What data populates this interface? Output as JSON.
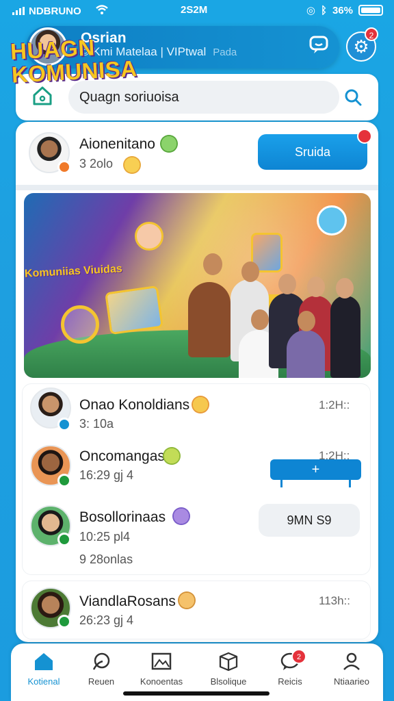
{
  "status_bar": {
    "carrier": "NDBRUNO",
    "time": "2S2M",
    "battery": "36%"
  },
  "header": {
    "title": "Osrian",
    "subtitle": "© Kmi Matelaa | VIPtwal",
    "subtitle_dim": "Pada",
    "notification_count": "2"
  },
  "search": {
    "value": "Quagn soriuoisa"
  },
  "top_post": {
    "name": "Aionenitano",
    "meta": "3 2olo",
    "button_label": "Sruida"
  },
  "banner": {
    "title_line1": "HUAGN",
    "title_line2": "KOMUNISA",
    "subtitle": "Komuniias Viuidas"
  },
  "messages": [
    {
      "name": "Onao Konoldians",
      "meta": "3: 10a",
      "time": "1:2H::"
    },
    {
      "name": "Oncomangas",
      "meta": "16:29 gj 4",
      "time": "1:2H::"
    },
    {
      "name": "Bosollorinaas",
      "meta": "10:25 pl4",
      "meta2": "9 28onlas",
      "action_label": "9MN S9"
    },
    {
      "name": "ViandlaRosans",
      "meta": "26:23 gj 4",
      "time": "113h::"
    }
  ],
  "plus_label": "+",
  "tabs": [
    {
      "label": "Kotienal",
      "icon": "home-icon"
    },
    {
      "label": "Reuen",
      "icon": "leaf-icon"
    },
    {
      "label": "Konoentas",
      "icon": "photo-icon"
    },
    {
      "label": "Blsolique",
      "icon": "box-icon"
    },
    {
      "label": "Reicis",
      "icon": "chat-icon"
    },
    {
      "label": "Ntiaarieo",
      "icon": "profile-icon"
    }
  ],
  "tab_badge": "2",
  "colors": {
    "accent": "#1592d2",
    "background": "#1aa6e4",
    "badge": "#e5323b",
    "online": "#1f9a3c"
  }
}
